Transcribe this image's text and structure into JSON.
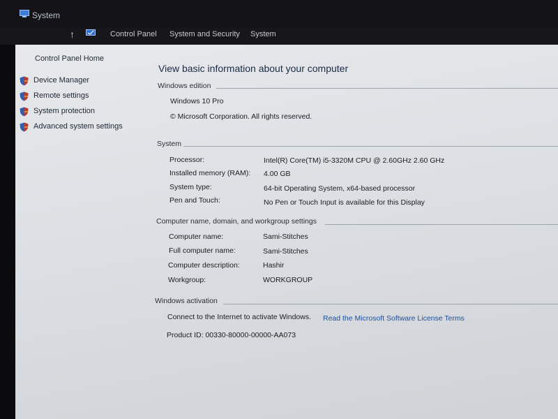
{
  "window": {
    "title": "System"
  },
  "breadcrumb": [
    "Control Panel",
    "System and Security",
    "System"
  ],
  "sidebar": {
    "home": "Control Panel Home",
    "items": [
      {
        "label": "Device Manager"
      },
      {
        "label": "Remote settings"
      },
      {
        "label": "System protection"
      },
      {
        "label": "Advanced system settings"
      }
    ]
  },
  "main": {
    "heading": "View basic information about your computer",
    "windows_edition": {
      "title": "Windows edition",
      "edition": "Windows 10 Pro",
      "copyright": "© Microsoft Corporation. All rights reserved."
    },
    "system": {
      "title": "System",
      "rows": [
        {
          "label": "Processor:",
          "value": "Intel(R) Core(TM) i5-3320M CPU @ 2.60GHz   2.60 GHz"
        },
        {
          "label": "Installed memory (RAM):",
          "value": "4.00 GB"
        },
        {
          "label": "System type:",
          "value": "64-bit Operating System, x64-based processor"
        },
        {
          "label": "Pen and Touch:",
          "value": "No Pen or Touch Input is available for this Display"
        }
      ]
    },
    "computer_name": {
      "title": "Computer name, domain, and workgroup settings",
      "rows": [
        {
          "label": "Computer name:",
          "value": "Sami-Stitches"
        },
        {
          "label": "Full computer name:",
          "value": "Sami-Stitches"
        },
        {
          "label": "Computer description:",
          "value": "Hashir"
        },
        {
          "label": "Workgroup:",
          "value": "WORKGROUP"
        }
      ]
    },
    "activation": {
      "title": "Windows activation",
      "message": "Connect to the Internet to activate Windows.",
      "license_link": "Read the Microsoft Software License Terms",
      "product_id": "Product ID: 00330-80000-00000-AA073"
    }
  },
  "colors": {
    "link": "#1c4f9e",
    "shield_red": "#c0392b",
    "shield_blue": "#2f5fb3"
  }
}
